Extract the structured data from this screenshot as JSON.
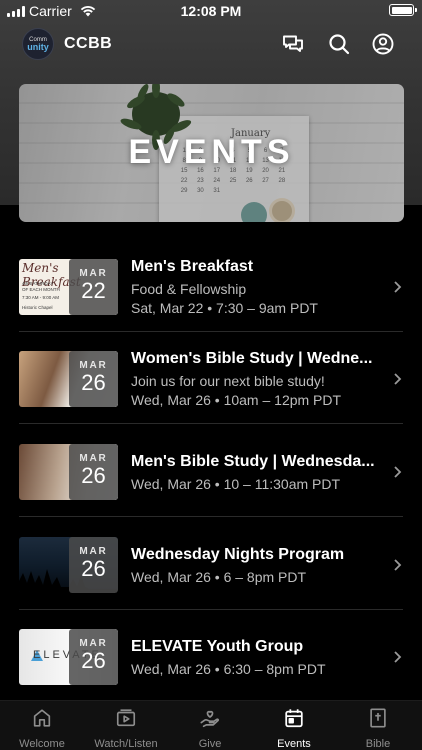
{
  "status_bar": {
    "carrier": "Carrier",
    "time": "12:08 PM"
  },
  "header": {
    "logo_line1": "Comm",
    "logo_line2": "unity",
    "title": "CCBB"
  },
  "hero": {
    "title": "EVENTS",
    "calendar_month": "January"
  },
  "events": [
    {
      "title": "Men's Breakfast",
      "subtitle": "Food & Fellowship",
      "when": "Sat, Mar 22 • 7:30 – 9am PDT",
      "month": "MAR",
      "day": "22",
      "thumb_text": {
        "script": "Men's Breakfast",
        "line1": "4th SATURDAY",
        "line2": "OF EACH MONTH",
        "line3": "7:30 AM - 9:00 AM",
        "line4": "Historic Chapel"
      }
    },
    {
      "title": "Women's Bible Study | Wedne...",
      "subtitle": "Join us for our next bible study!",
      "when": "Wed, Mar 26 • 10am – 12pm PDT",
      "month": "MAR",
      "day": "26"
    },
    {
      "title": "Men's Bible Study | Wednesda...",
      "subtitle": "",
      "when": "Wed, Mar 26 • 10 – 11:30am PDT",
      "month": "MAR",
      "day": "26"
    },
    {
      "title": "Wednesday Nights Program",
      "subtitle": "",
      "when": "Wed, Mar 26 • 6 – 8pm PDT",
      "month": "MAR",
      "day": "26"
    },
    {
      "title": "ELEVATE Youth Group",
      "subtitle": "",
      "when": "Wed, Mar 26 • 6:30 – 8pm PDT",
      "month": "MAR",
      "day": "26",
      "thumb_text": "ELEVATE"
    }
  ],
  "tabs": [
    {
      "label": "Welcome",
      "icon": "home-icon",
      "active": false
    },
    {
      "label": "Watch/Listen",
      "icon": "play-icon",
      "active": false
    },
    {
      "label": "Give",
      "icon": "give-hand-heart-icon",
      "active": false
    },
    {
      "label": "Events",
      "icon": "calendar-icon",
      "active": true
    },
    {
      "label": "Bible",
      "icon": "bible-icon",
      "active": false
    }
  ],
  "colors": {
    "background": "#000000",
    "header_gradient": "#3e3e3e",
    "muted_text": "#bdbdbd",
    "inactive_tab": "#8e8e8e",
    "active_tab": "#ffffff"
  }
}
